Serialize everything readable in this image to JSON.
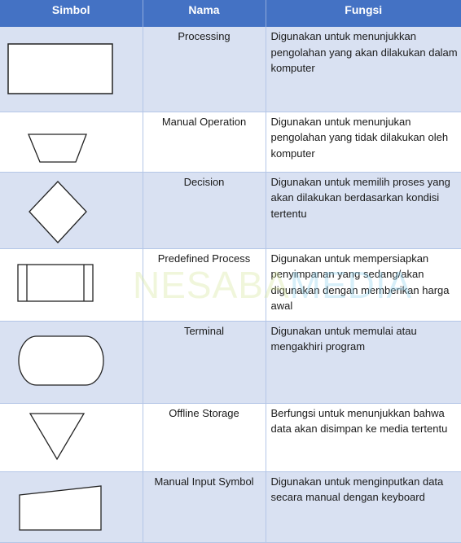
{
  "table": {
    "headers": [
      "Simbol",
      "Nama",
      "Fungsi"
    ],
    "rows": [
      {
        "symbol": "processing-rectangle",
        "nama": "Processing",
        "fungsi": "Digunakan untuk menunjukkan pengolahan yang akan dilakukan dalam komputer"
      },
      {
        "symbol": "manual-operation-trapezoid",
        "nama": "Manual Operation",
        "fungsi": "Digunakan untuk menunjukan pengolahan yang tidak dilakukan oleh komputer"
      },
      {
        "symbol": "decision-diamond",
        "nama": "Decision",
        "fungsi": "Digunakan untuk memilih proses yang akan dilakukan berdasarkan kondisi tertentu"
      },
      {
        "symbol": "predefined-process",
        "nama": "Predefined Process",
        "fungsi": "Digunakan untuk mempersiapkan penyimpanan yang sedang/akan digunakan dengan memberikan harga awal"
      },
      {
        "symbol": "terminal-rounded",
        "nama": "Terminal",
        "fungsi": "Digunakan untuk memulai atau mengakhiri program"
      },
      {
        "symbol": "offline-storage-triangle",
        "nama": "Offline Storage",
        "fungsi": "Berfungsi untuk menunjukkan bahwa data akan disimpan ke media tertentu"
      },
      {
        "symbol": "manual-input",
        "nama": "Manual Input Symbol",
        "fungsi": "Digunakan untuk menginputkan data secara manual dengan keyboard"
      }
    ]
  },
  "watermark": {
    "part1": "NESABA",
    "part2": "MEDIA"
  },
  "colors": {
    "header_bg": "#4472c4",
    "band_bg": "#d9e1f2",
    "border": "#b4c6e7"
  }
}
